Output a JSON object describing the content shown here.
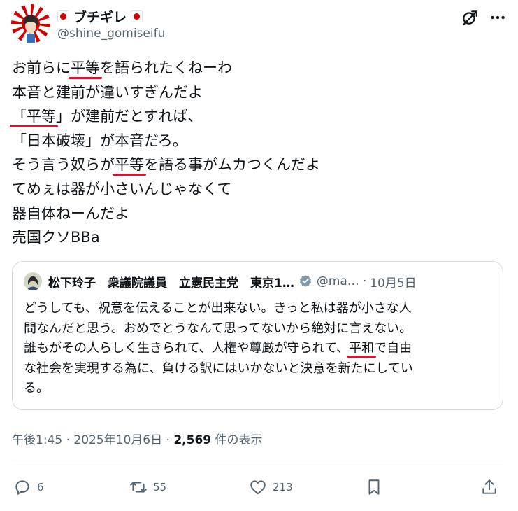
{
  "author": {
    "display_name": "ブチギレ",
    "handle": "@shine_gomiseifu"
  },
  "tweet": {
    "lines": [
      [
        "お前らに",
        "平等",
        "を語られたくねーわ"
      ],
      [
        "本音と建前が違いすぎんだよ"
      ],
      [
        "「",
        "平等",
        "」が建前だとすれば、"
      ],
      [
        "「日本破壊」が本音だろ。"
      ],
      [
        "そう言う奴らが",
        "平等",
        "を語る事がムカつくんだよ"
      ],
      [
        "てめぇは器が小さいんじゃなくて"
      ],
      [
        "器自体ねーんだよ"
      ],
      [
        "売国クソBBa"
      ]
    ]
  },
  "quote": {
    "name": "松下玲子　衆議院議員　立憲民主党　東京1…",
    "handle": "@ma…",
    "separator": "·",
    "date": "10月5日",
    "lines": [
      [
        "どうしても、祝意を伝えることが出来ない。きっと私は器が小さな人"
      ],
      [
        "間なんだと思う。おめでとうなんて思ってないから絶対に言えない。"
      ],
      [
        "誰もがその人らしく生きられて、人権や尊厳が守られて、",
        "平和",
        "で自由"
      ],
      [
        "な社会を実現する為に、負ける訳にはいかないと決意を新たにしてい"
      ],
      [
        "る。"
      ]
    ]
  },
  "meta": {
    "time": "午後1:45",
    "sep1": " · ",
    "date": "2025年10月6日",
    "sep2": " · ",
    "views": "2,569",
    "views_label": " 件の表示"
  },
  "actions": {
    "replies": "6",
    "retweets": "55",
    "likes": "213"
  },
  "colors": {
    "underline": "#e0102e",
    "muted": "#536471",
    "verified": "#829aab"
  }
}
